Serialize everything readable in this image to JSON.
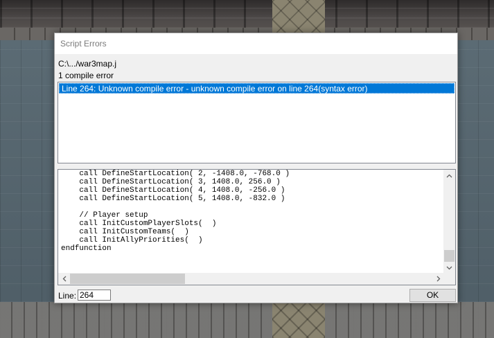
{
  "dialog": {
    "title": "Script Errors",
    "file_path": "C:\\.../war3map.j",
    "error_count": "1 compile error",
    "errors": [
      "Line 264: Unknown compile error - unknown compile error on line 264(syntax error)"
    ],
    "code_lines": [
      "    call DefineStartLocation( 2, -1408.0, -768.0 )",
      "    call DefineStartLocation( 3, 1408.0, 256.0 )",
      "    call DefineStartLocation( 4, 1408.0, -256.0 )",
      "    call DefineStartLocation( 5, 1408.0, -832.0 )",
      "",
      "    // Player setup",
      "    call InitCustomPlayerSlots(  )",
      "    call InitCustomTeams(  )",
      "    call InitAllyPriorities(  )",
      "endfunction"
    ],
    "line_label": "Line:",
    "line_value": "264",
    "ok_label": "OK"
  },
  "icons": {
    "scroll_up": "chevron-up-icon",
    "scroll_down": "chevron-down-icon",
    "scroll_left": "chevron-left-icon",
    "scroll_right": "chevron-right-icon"
  },
  "colors": {
    "selection": "#0078d7",
    "dialog_bg": "#f0f0f0"
  }
}
